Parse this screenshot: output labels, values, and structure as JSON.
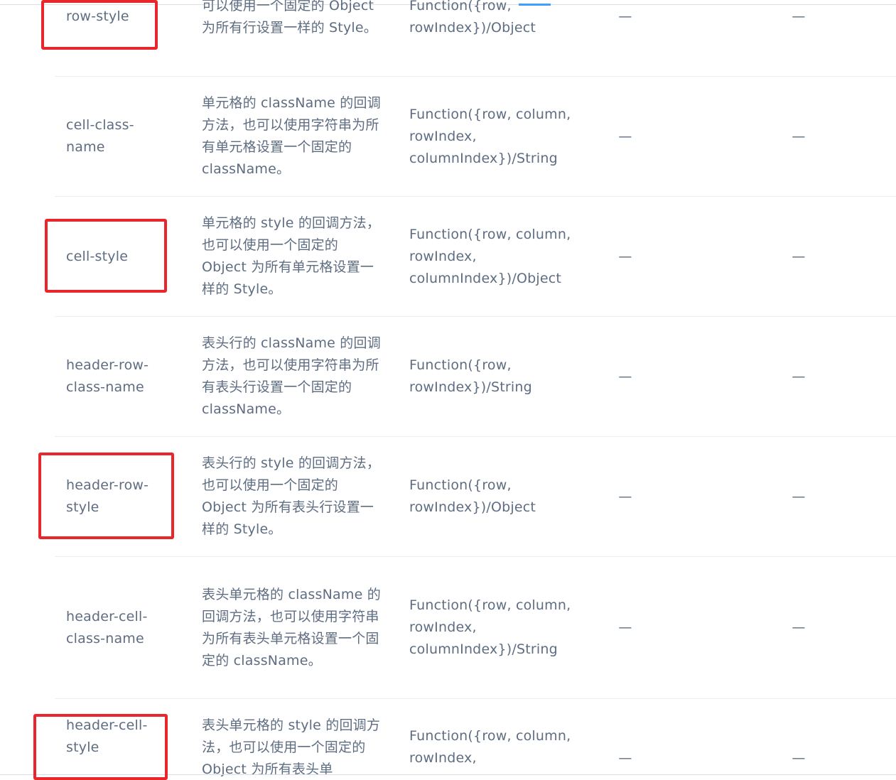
{
  "rows": [
    {
      "name": "row-style",
      "description": "可以使用一个固定的 Object 为所有行设置一样的 Style。",
      "type": "Function({row, rowIndex})/Object",
      "options": "—",
      "default": "—"
    },
    {
      "name": "cell-class-name",
      "description": "单元格的 className 的回调方法，也可以使用字符串为所有单元格设置一个固定的 className。",
      "type": "Function({row, column, rowIndex, columnIndex})/String",
      "options": "—",
      "default": "—"
    },
    {
      "name": "cell-style",
      "description": "单元格的 style 的回调方法，也可以使用一个固定的 Object 为所有单元格设置一样的 Style。",
      "type": "Function({row, column, rowIndex, columnIndex})/Object",
      "options": "—",
      "default": "—"
    },
    {
      "name": "header-row-class-name",
      "description": "表头行的 className 的回调方法，也可以使用字符串为所有表头行设置一个固定的 className。",
      "type": "Function({row, rowIndex})/String",
      "options": "—",
      "default": "—"
    },
    {
      "name": "header-row-style",
      "description": "表头行的 style 的回调方法，也可以使用一个固定的 Object 为所有表头行设置一样的 Style。",
      "type": "Function({row, rowIndex})/Object",
      "options": "—",
      "default": "—"
    },
    {
      "name": "header-cell-class-name",
      "description": "表头单元格的 className 的回调方法，也可以使用字符串为所有表头单元格设置一个固定的 className。",
      "type": "Function({row, column, rowIndex, columnIndex})/String",
      "options": "—",
      "default": "—"
    },
    {
      "name": "header-cell-style",
      "description": "表头单元格的 style 的回调方法，也可以使用一个固定的 Object 为所有表头单",
      "type": "Function({row, column, rowIndex,",
      "options": "—",
      "default": "—"
    }
  ],
  "colors": {
    "text": "#5e6d82",
    "divider": "#ebeef5",
    "highlight": "#e8262b",
    "accent": "#409eff"
  }
}
